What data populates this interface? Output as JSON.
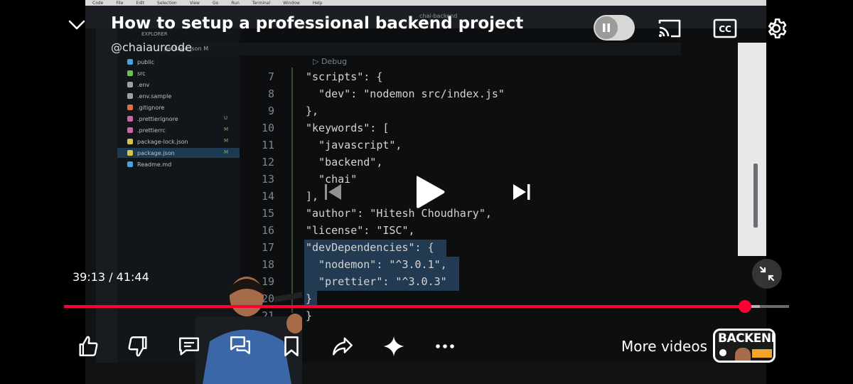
{
  "video": {
    "title": "How to setup a professional backend project",
    "channel": "@chaiaurcode",
    "time_current": "39:13",
    "time_sep": " / ",
    "time_total": "41:44",
    "progress_fraction": 0.9397,
    "buffered_fraction": 0.96
  },
  "controls": {
    "more_videos_label": "More videos",
    "thumbnail_text": "BACKEND"
  },
  "colors": {
    "progress": "#ff0033",
    "overlay_text": "#ffffff"
  },
  "vscode": {
    "explorer_title": "EXPLORER",
    "window_title": "chai-backend",
    "tab_label": "package.json M",
    "breadcrumb": "▷ Debug",
    "files": [
      {
        "name": "public",
        "color": "#4aa3df",
        "badge": ""
      },
      {
        "name": "src",
        "color": "#6bbf59",
        "badge": ""
      },
      {
        "name": ".env",
        "color": "#a0a0a0",
        "badge": ""
      },
      {
        "name": ".env.sample",
        "color": "#a0a0a0",
        "badge": ""
      },
      {
        "name": ".gitignore",
        "color": "#e06c4a",
        "badge": ""
      },
      {
        "name": ".prettierignore",
        "color": "#c76aa0",
        "badge": "U"
      },
      {
        "name": ".prettierrc",
        "color": "#c76aa0",
        "badge": "M"
      },
      {
        "name": "package-lock.json",
        "color": "#d6c34a",
        "badge": "M"
      },
      {
        "name": "package.json",
        "color": "#d6c34a",
        "badge": "M"
      },
      {
        "name": "Readme.md",
        "color": "#4aa3df",
        "badge": ""
      }
    ],
    "code_lines": [
      {
        "n": "7",
        "t": "\"scripts\": {"
      },
      {
        "n": "8",
        "t": "  \"dev\": \"nodemon src/index.js\""
      },
      {
        "n": "9",
        "t": "},"
      },
      {
        "n": "10",
        "t": "\"keywords\": ["
      },
      {
        "n": "11",
        "t": "  \"javascript\","
      },
      {
        "n": "12",
        "t": "  \"backend\","
      },
      {
        "n": "13",
        "t": "  \"chai\""
      },
      {
        "n": "14",
        "t": "],"
      },
      {
        "n": "15",
        "t": "\"author\": \"Hitesh Choudhary\","
      },
      {
        "n": "16",
        "t": "\"license\": \"ISC\","
      },
      {
        "n": "17",
        "t": "\"devDependencies\": {"
      },
      {
        "n": "18",
        "t": "  \"nodemon\": \"^3.0.1\","
      },
      {
        "n": "19",
        "t": "  \"prettier\": \"^3.0.3\""
      },
      {
        "n": "20",
        "t": "}"
      },
      {
        "n": "21",
        "t": "}"
      },
      {
        "n": "22",
        "t": ""
      }
    ]
  }
}
